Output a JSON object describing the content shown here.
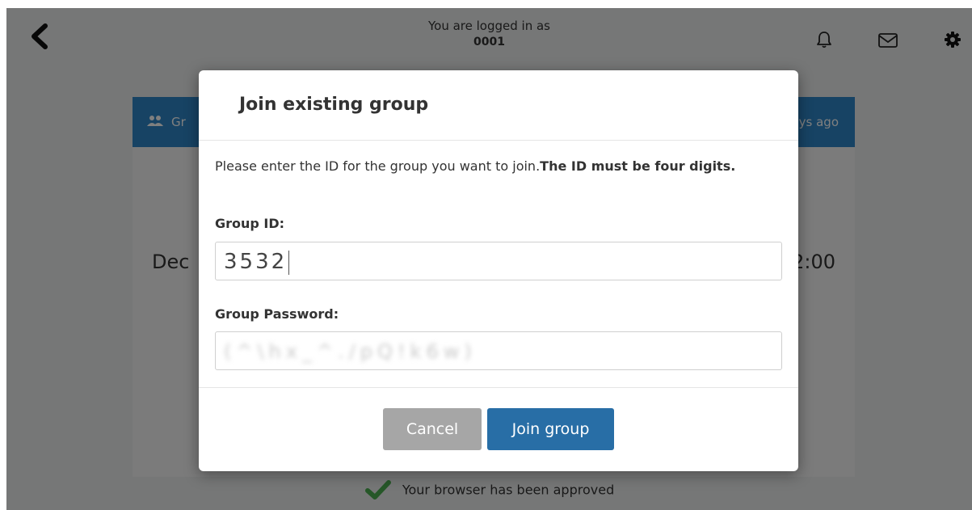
{
  "topbar": {
    "login_line1": "You are logged in as",
    "user_id": "0001",
    "icons": [
      "back-icon",
      "bell-icon",
      "mail-icon",
      "gear-icon"
    ]
  },
  "card": {
    "title_fragment": "Gr",
    "time_ago_fragment": "ys ago",
    "date_fragment": "Dec",
    "time_fragment": "2:00",
    "header_color": "#2e87c8"
  },
  "status": {
    "approved_text": "Your browser has been approved",
    "check_color": "#4caf50"
  },
  "modal": {
    "title": "Join existing group",
    "instruction_plain": "Please enter the ID for the group you want to join.",
    "instruction_bold": "The ID must be four digits.",
    "group_id_label": "Group ID:",
    "group_id_value": "3532",
    "group_password_label": "Group Password:",
    "group_password_value": "(^\\hx_^./pQ!k6w)",
    "cancel_label": "Cancel",
    "join_label": "Join group",
    "join_color": "#286ea6",
    "cancel_color": "#a6a6a6"
  }
}
